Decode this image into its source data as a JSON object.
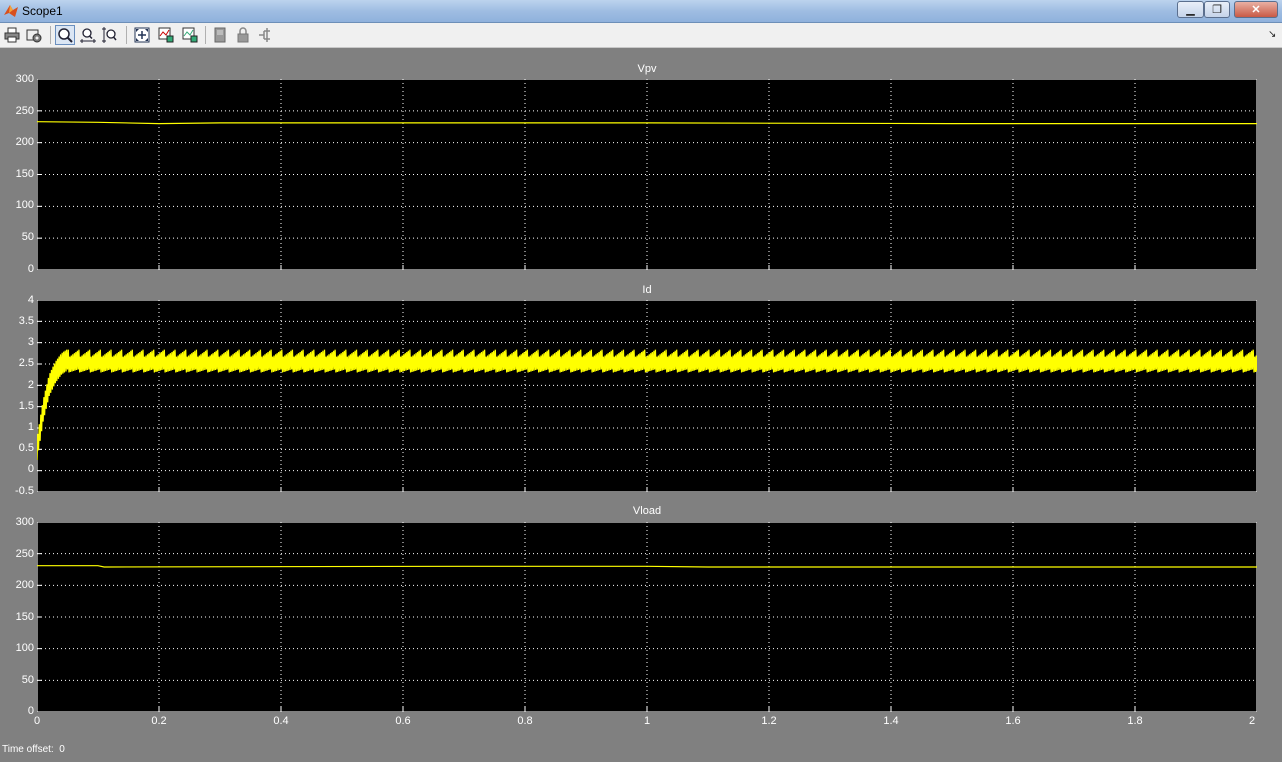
{
  "window": {
    "title": "Scope1",
    "min_label": "▁",
    "max_label": "❐",
    "close_label": "✕"
  },
  "toolbar": {
    "buttons": [
      {
        "name": "print-icon",
        "label": "print"
      },
      {
        "name": "parameters-icon",
        "label": "parameters"
      },
      {
        "name": "zoom-icon",
        "label": "zoom",
        "active": true
      },
      {
        "name": "zoom-x-icon",
        "label": "zoom-x"
      },
      {
        "name": "zoom-y-icon",
        "label": "zoom-y"
      },
      {
        "name": "autoscale-icon",
        "label": "autoscale"
      },
      {
        "name": "save-axes-icon",
        "label": "save axes"
      },
      {
        "name": "restore-axes-icon",
        "label": "restore axes"
      },
      {
        "name": "floating-scope-icon",
        "label": "floating scope"
      },
      {
        "name": "lock-icon",
        "label": "lock axes"
      },
      {
        "name": "signal-selector-icon",
        "label": "signal selector"
      }
    ],
    "dock_label": "↘"
  },
  "chart_data": [
    {
      "type": "line",
      "title": "Vpv",
      "xlim": [
        0,
        2
      ],
      "ylim": [
        0,
        300
      ],
      "yticks": [
        "0",
        "50",
        "100",
        "150",
        "200",
        "250",
        "300"
      ],
      "grid": true,
      "series": [
        {
          "x": [
            0,
            0.1,
            0.2,
            0.3,
            0.5,
            1.0,
            1.5,
            2.0
          ],
          "values": [
            233,
            232,
            230,
            231,
            231,
            231,
            230,
            230
          ],
          "color": "#ffff00"
        }
      ]
    },
    {
      "type": "line",
      "title": "Id",
      "xlim": [
        0,
        2
      ],
      "ylim": [
        -0.5,
        4
      ],
      "yticks": [
        "-0.5",
        "0",
        "0.5",
        "1",
        "1.5",
        "2",
        "2.5",
        "3",
        "3.5",
        "4"
      ],
      "grid": true,
      "series": [
        {
          "x": [
            0,
            0.01,
            0.02,
            0.03,
            0.04,
            0.05,
            2.0
          ],
          "values": [
            0.5,
            1.4,
            2.0,
            2.3,
            2.5,
            2.6,
            2.6
          ],
          "ripple": [
            2.3,
            2.85
          ],
          "color": "#ffff00"
        }
      ]
    },
    {
      "type": "line",
      "title": "Vload",
      "xlim": [
        0,
        2
      ],
      "ylim": [
        0,
        300
      ],
      "yticks": [
        "0",
        "50",
        "100",
        "150",
        "200",
        "250",
        "300"
      ],
      "xticks": [
        "0",
        "0.2",
        "0.4",
        "0.6",
        "0.8",
        "1",
        "1.2",
        "1.4",
        "1.6",
        "1.8",
        "2"
      ],
      "grid": true,
      "series": [
        {
          "x": [
            0,
            0.1,
            0.11,
            0.7,
            1.0,
            1.1,
            2.0
          ],
          "values": [
            231,
            231,
            229,
            230,
            230,
            229,
            229
          ],
          "color": "#ffff00"
        }
      ]
    }
  ],
  "footer": {
    "time_offset_label": "Time offset:",
    "time_offset_value": "0"
  }
}
